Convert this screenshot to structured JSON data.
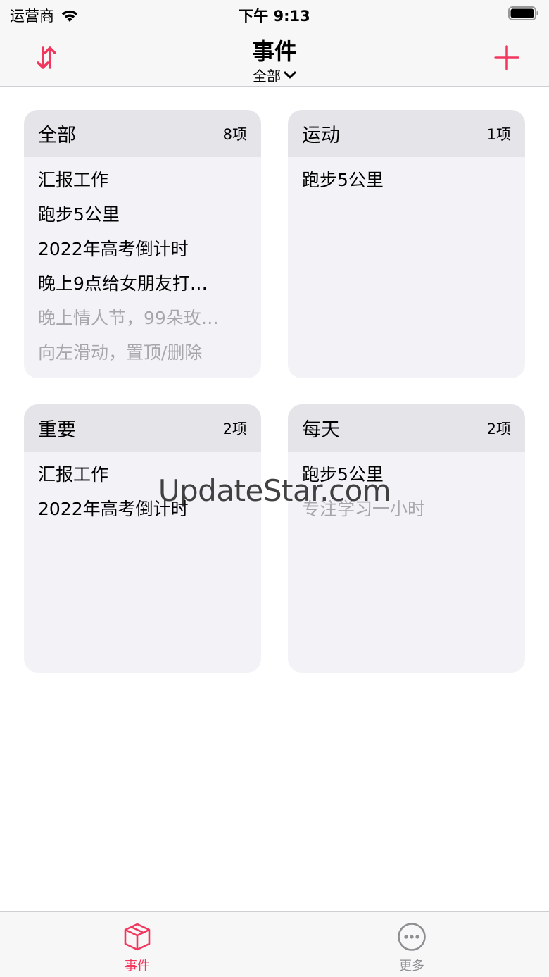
{
  "status_bar": {
    "carrier": "运营商",
    "time": "下午 9:13"
  },
  "nav": {
    "title": "事件",
    "filter": "全部"
  },
  "cards": {
    "all": {
      "title": "全部",
      "count": "8项",
      "items": [
        "汇报工作",
        "跑步5公里",
        "2022年高考倒计时",
        "晚上9点给女朋友打…",
        "晚上情人节，99朵玫…",
        "向左滑动，置顶/删除"
      ]
    },
    "sport": {
      "title": "运动",
      "count": "1项",
      "items": [
        "跑步5公里"
      ]
    },
    "important": {
      "title": "重要",
      "count": "2项",
      "items": [
        "汇报工作",
        "2022年高考倒计时"
      ]
    },
    "daily": {
      "title": "每天",
      "count": "2项",
      "items": [
        "跑步5公里",
        "专注学习一小时"
      ]
    }
  },
  "watermark": "UpdateStar.com",
  "tabs": {
    "events": "事件",
    "more": "更多"
  },
  "colors": {
    "accent": "#f2375e",
    "muted_text": "#a7a7ab",
    "card_bg": "#f2f2f7",
    "card_header_bg": "#e4e4e9"
  },
  "icons": {
    "sort": "sort-arrows-icon",
    "add": "plus-icon",
    "events_tab": "cube-icon",
    "more_tab": "ellipsis-circle-icon"
  }
}
